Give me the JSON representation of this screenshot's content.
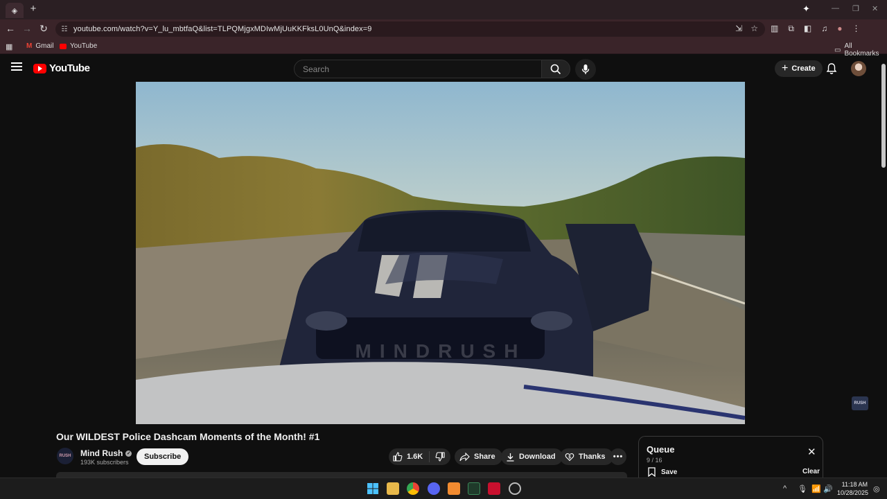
{
  "browser": {
    "url": "youtube.com/watch?v=Y_lu_mbtfaQ&list=TLPQMjgxMDIwMjUuKKFksL0UnQ&index=9",
    "bookmarks": [
      {
        "label": "Gmail",
        "icon": "gmail-icon"
      },
      {
        "label": "YouTube",
        "icon": "youtube-icon"
      }
    ],
    "all_bookmarks": "All Bookmarks"
  },
  "youtube": {
    "logo_text": "YouTube",
    "search_placeholder": "Search",
    "create_label": "Create"
  },
  "video": {
    "title": "Our WILDEST Police Dashcam Moments of the Month! #1",
    "watermark": "MINDRUSH"
  },
  "channel": {
    "name": "Mind Rush",
    "subscribers": "193K subscribers",
    "avatar_text": "RUSH",
    "subscribe_label": "Subscribe"
  },
  "actions": {
    "likes": "1.6K",
    "share": "Share",
    "download": "Download",
    "thanks": "Thanks"
  },
  "queue": {
    "title": "Queue",
    "count": "9 / 16",
    "save": "Save",
    "clear": "Clear"
  },
  "taskbar": {
    "time": "11:18 AM",
    "date": "10/28/2025"
  },
  "colors": {
    "accent_red": "#ff0000",
    "background": "#0f0f0f",
    "chrome": "#3a2429"
  }
}
